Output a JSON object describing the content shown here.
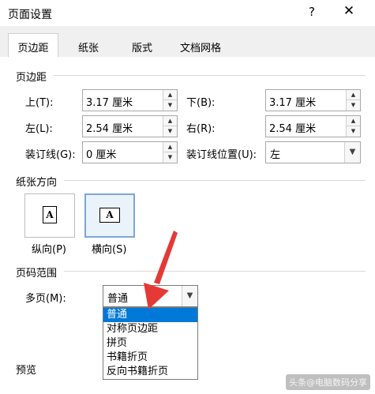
{
  "window": {
    "title": "页面设置",
    "help_glyph": "?",
    "close_glyph": "✕"
  },
  "tabs": [
    {
      "label": "页边距"
    },
    {
      "label": "纸张"
    },
    {
      "label": "版式"
    },
    {
      "label": "文档网格"
    }
  ],
  "margins": {
    "section_title": "页边距",
    "top": {
      "label": "上(T):",
      "value": "3.17 厘米"
    },
    "bottom": {
      "label": "下(B):",
      "value": "3.17 厘米"
    },
    "left": {
      "label": "左(L):",
      "value": "2.54 厘米"
    },
    "right": {
      "label": "右(R):",
      "value": "2.54 厘米"
    },
    "gutter": {
      "label": "装订线(G):",
      "value": "0 厘米"
    },
    "gutter_position": {
      "label": "装订线位置(U):",
      "value": "左"
    }
  },
  "orientation": {
    "section_title": "纸张方向",
    "portrait": {
      "label": "纵向(P)",
      "glyph": "A"
    },
    "landscape": {
      "label": "横向(S)",
      "glyph": "A"
    },
    "selected": "landscape"
  },
  "pages": {
    "section_title": "页码范围",
    "multiple_label": "多页(M):",
    "selected": "普通",
    "options": [
      "普通",
      "对称页边距",
      "拼页",
      "书籍折页",
      "反向书籍折页"
    ],
    "highlighted_index": 0
  },
  "preview": {
    "section_title": "预览"
  },
  "watermark": "头条@电脑数码分享",
  "colors": {
    "accent": "#0078d7",
    "arrow": "#e53935"
  }
}
